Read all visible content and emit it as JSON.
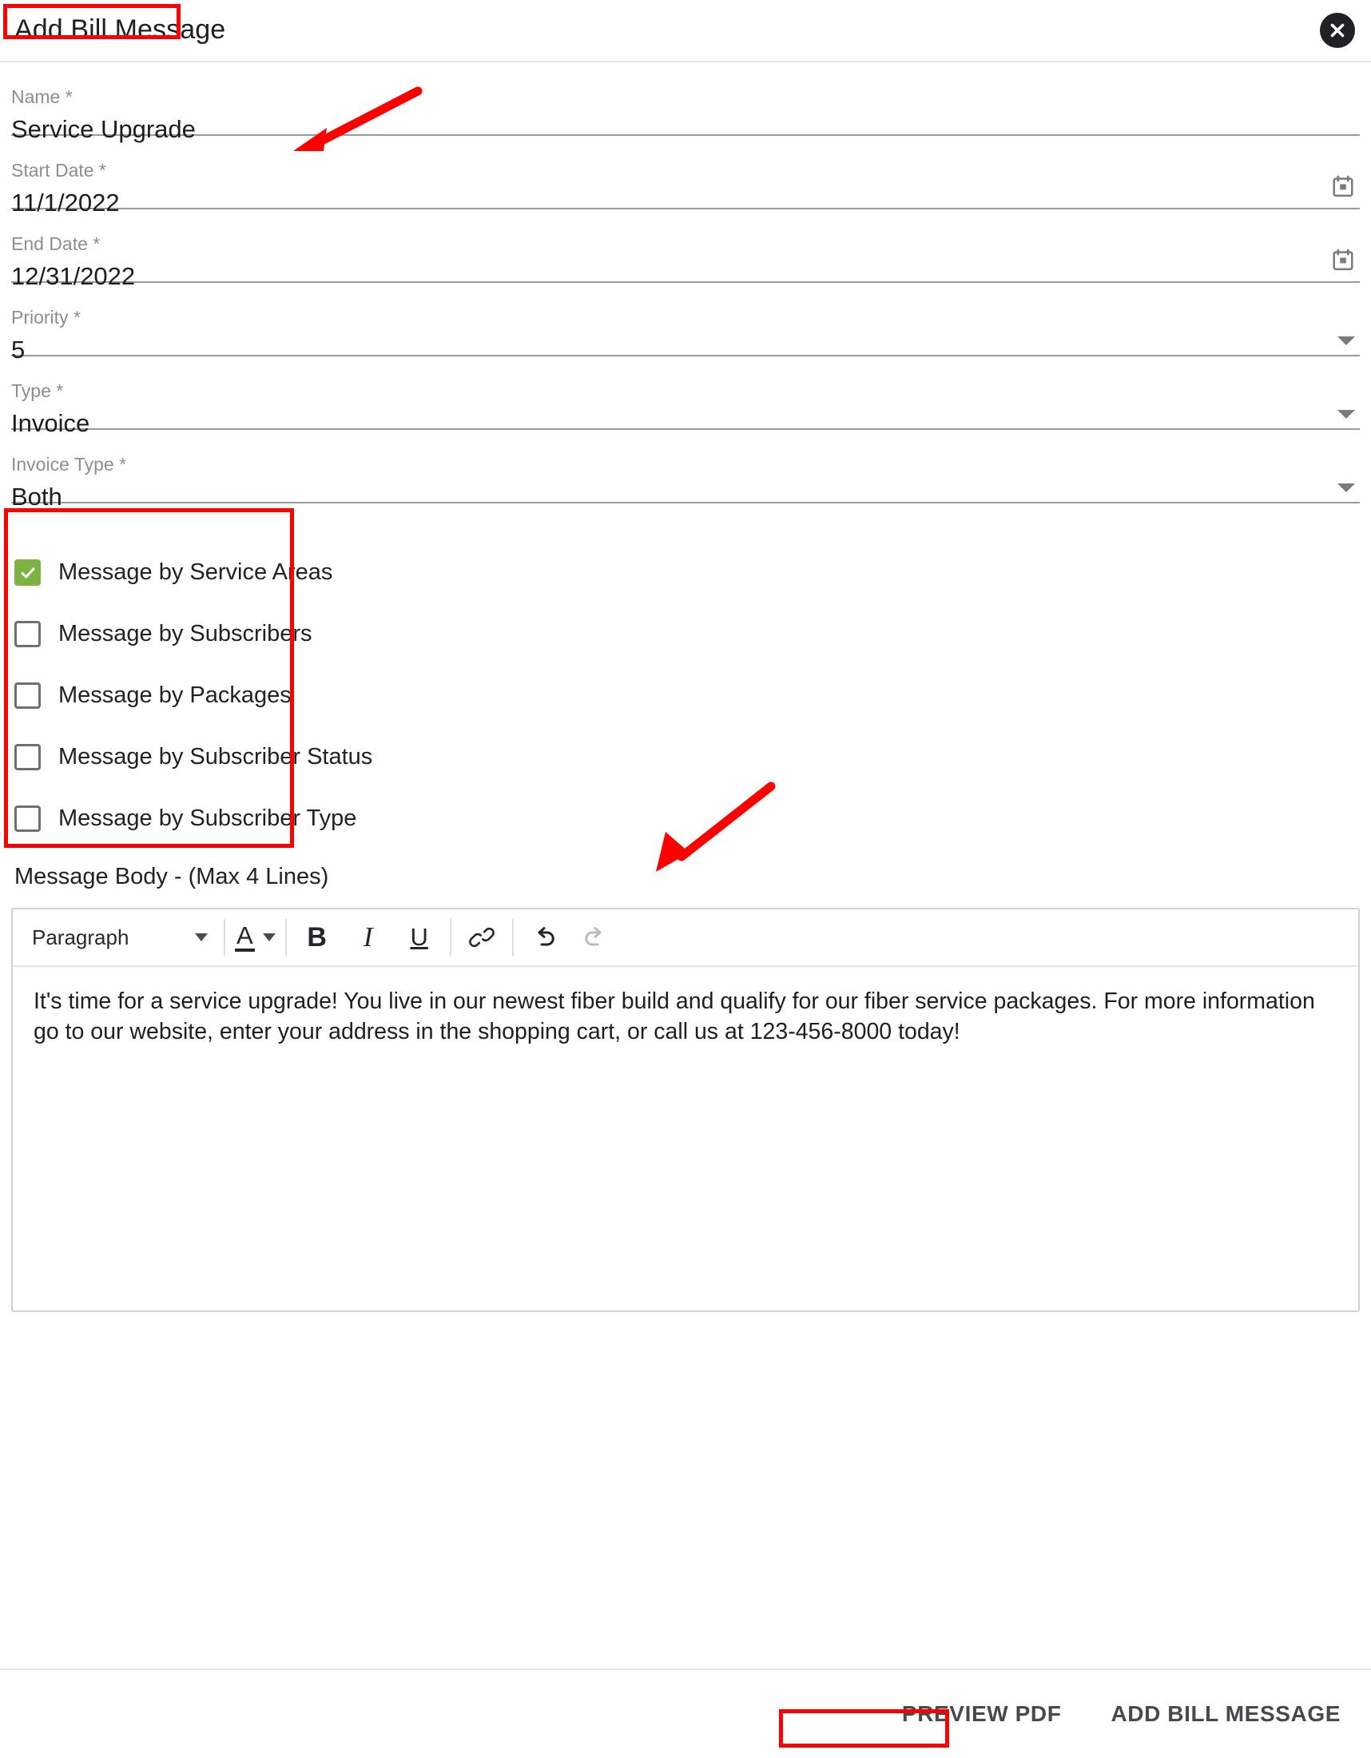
{
  "dialog": {
    "title": "Add Bill Message",
    "close_icon": "close-circle-icon"
  },
  "form": {
    "fields": [
      {
        "label": "Name *",
        "value": "Service Upgrade",
        "trailing": "none"
      },
      {
        "label": "Start Date *",
        "value": "11/1/2022",
        "trailing": "calendar-icon"
      },
      {
        "label": "End Date *",
        "value": "12/31/2022",
        "trailing": "calendar-icon"
      },
      {
        "label": "Priority *",
        "value": "5",
        "trailing": "chevron-down-icon"
      },
      {
        "label": "Type *",
        "value": "Invoice",
        "trailing": "chevron-down-icon"
      },
      {
        "label": "Invoice Type *",
        "value": "Both",
        "trailing": "chevron-down-icon"
      }
    ]
  },
  "checkboxes": [
    {
      "label": "Message by Service Areas",
      "checked": true
    },
    {
      "label": "Message by Subscribers",
      "checked": false
    },
    {
      "label": "Message by Packages",
      "checked": false
    },
    {
      "label": "Message by Subscriber Status",
      "checked": false
    },
    {
      "label": "Message by Subscriber Type",
      "checked": false
    }
  ],
  "message_body": {
    "label": "Message Body - (Max 4 Lines)",
    "toolbar": {
      "block_format": "Paragraph",
      "block_format_icon": "chevron-down-icon",
      "text_color_icon": "text-color-icon",
      "text_color_chevron_icon": "chevron-down-icon",
      "bold_label": "B",
      "bold_icon": "bold-icon",
      "italic_label": "I",
      "italic_icon": "italic-icon",
      "underline_label": "U",
      "underline_icon": "underline-icon",
      "link_icon": "link-icon",
      "undo_icon": "undo-icon",
      "redo_icon": "redo-icon"
    },
    "content": "It's time for a service upgrade! You live in our newest fiber build and qualify for our fiber service packages. For more information go to our website, enter your address in the shopping cart, or call us at 123-456-8000 today!"
  },
  "footer": {
    "preview_label": "PREVIEW PDF",
    "submit_label": "ADD BILL MESSAGE"
  },
  "colors": {
    "annotation": "#ff0000",
    "checkbox_checked": "#7cb342",
    "close_button": "#202124"
  }
}
